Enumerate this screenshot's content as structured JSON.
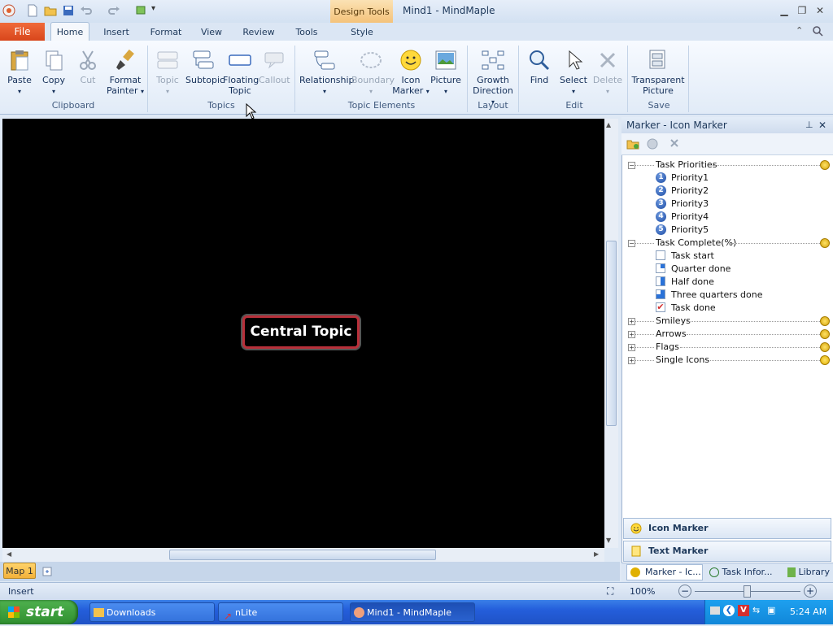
{
  "titlebar": {
    "design_tools": "Design Tools",
    "app_title": "Mind1  -  MindMaple"
  },
  "tabs": {
    "file": "File",
    "home": "Home",
    "insert": "Insert",
    "format": "Format",
    "view": "View",
    "review": "Review",
    "tools": "Tools",
    "style": "Style"
  },
  "ribbon": {
    "paste": "Paste",
    "copy": "Copy",
    "cut": "Cut",
    "format_painter_1": "Format",
    "format_painter_2": "Painter",
    "clipboard": "Clipboard",
    "topic": "Topic",
    "subtopic": "Subtopic",
    "floating_1": "Floating",
    "floating_2": "Topic",
    "callout": "Callout",
    "topics": "Topics",
    "relationship": "Relationship",
    "boundary": "Boundary",
    "icon_marker_1": "Icon",
    "icon_marker_2": "Marker",
    "picture": "Picture",
    "topic_elements": "Topic Elements",
    "growth_1": "Growth",
    "growth_2": "Direction",
    "layout": "Layout",
    "find": "Find",
    "select": "Select",
    "delete": "Delete",
    "edit": "Edit",
    "transparent_1": "Transparent",
    "transparent_2": "Picture",
    "save": "Save"
  },
  "canvas": {
    "central_topic": "Central Topic"
  },
  "sheet": {
    "tab": "Map 1"
  },
  "panel": {
    "title": "Marker - Icon Marker",
    "tree": {
      "task_priorities": "Task Priorities",
      "priorities": [
        "Priority1",
        "Priority2",
        "Priority3",
        "Priority4",
        "Priority5"
      ],
      "task_complete": "Task Complete(%)",
      "completes": [
        "Task start",
        "Quarter done",
        "Half done",
        "Three quarters done",
        "Task done"
      ],
      "smileys": "Smileys",
      "arrows": "Arrows",
      "flags": "Flags",
      "single_icons": "Single Icons"
    },
    "btn_icon_marker": "Icon Marker",
    "btn_text_marker": "Text Marker",
    "tab_marker": "Marker - Ic...",
    "tab_task": "Task Infor...",
    "tab_library": "Library"
  },
  "status": {
    "mode": "Insert",
    "zoom": "100%"
  },
  "taskbar": {
    "start": "start",
    "downloads": "Downloads",
    "nlite": "nLite",
    "mindmaple": "Mind1 - MindMaple",
    "clock": "5:24 AM"
  },
  "colors": {
    "file_tab": "#d8461b",
    "topic_border": "#b8303a",
    "canvas": "#000000",
    "taskbar": "#245edb"
  }
}
